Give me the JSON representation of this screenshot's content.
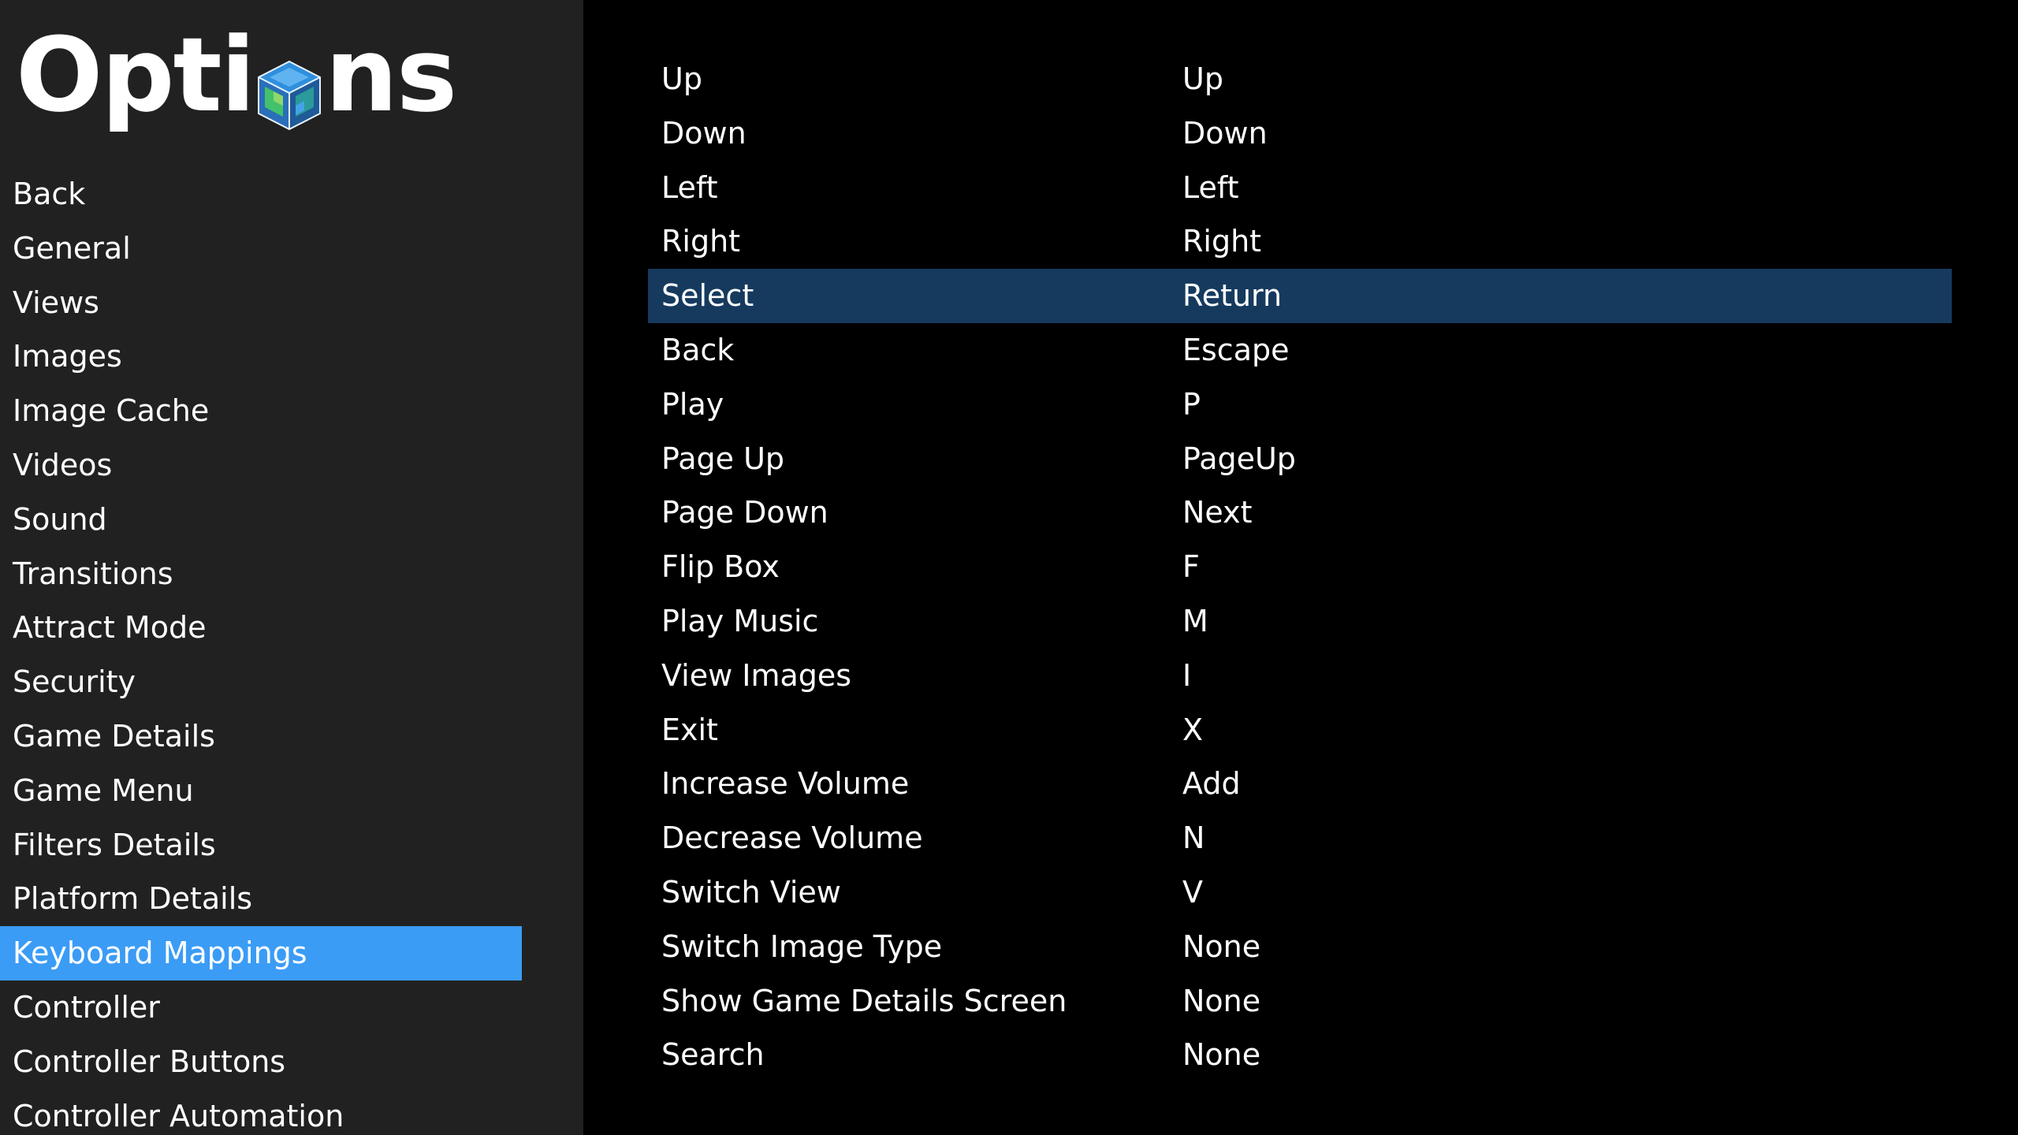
{
  "header": {
    "title_prefix": "Opti",
    "title_suffix": "ns",
    "logo_icon": "cube-icon"
  },
  "sidebar": {
    "items": [
      {
        "label": "Back"
      },
      {
        "label": "General"
      },
      {
        "label": "Views"
      },
      {
        "label": "Images"
      },
      {
        "label": "Image Cache"
      },
      {
        "label": "Videos"
      },
      {
        "label": "Sound"
      },
      {
        "label": "Transitions"
      },
      {
        "label": "Attract Mode"
      },
      {
        "label": "Security"
      },
      {
        "label": "Game Details"
      },
      {
        "label": "Game Menu"
      },
      {
        "label": "Filters Details"
      },
      {
        "label": "Platform Details"
      },
      {
        "label": "Keyboard Mappings"
      },
      {
        "label": "Controller"
      },
      {
        "label": "Controller Buttons"
      },
      {
        "label": "Controller Automation"
      }
    ],
    "selected_index": 14
  },
  "mappings": {
    "rows": [
      {
        "action": "Up",
        "key": "Up"
      },
      {
        "action": "Down",
        "key": "Down"
      },
      {
        "action": "Left",
        "key": "Left"
      },
      {
        "action": "Right",
        "key": "Right"
      },
      {
        "action": "Select",
        "key": "Return"
      },
      {
        "action": "Back",
        "key": "Escape"
      },
      {
        "action": "Play",
        "key": "P"
      },
      {
        "action": "Page Up",
        "key": "PageUp"
      },
      {
        "action": "Page Down",
        "key": "Next"
      },
      {
        "action": "Flip Box",
        "key": "F"
      },
      {
        "action": "Play Music",
        "key": "M"
      },
      {
        "action": "View Images",
        "key": "I"
      },
      {
        "action": "Exit",
        "key": "X"
      },
      {
        "action": "Increase Volume",
        "key": "Add"
      },
      {
        "action": "Decrease Volume",
        "key": "N"
      },
      {
        "action": "Switch View",
        "key": "V"
      },
      {
        "action": "Switch Image Type",
        "key": "None"
      },
      {
        "action": "Show Game Details Screen",
        "key": "None"
      },
      {
        "action": "Search",
        "key": "None"
      }
    ],
    "selected_index": 4
  },
  "colors": {
    "background": "#000000",
    "sidebar_background": "#212121",
    "sidebar_selected": "#3b9cf5",
    "row_selected": "#163a5e",
    "text": "#ffffff"
  }
}
